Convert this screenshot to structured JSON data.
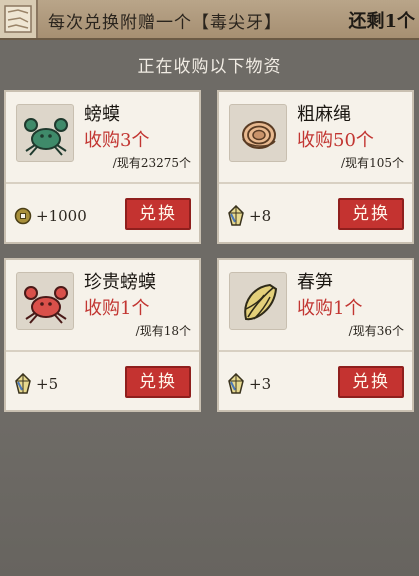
{
  "header": {
    "title": "每次兑换附赠一个【毒尖牙】",
    "remaining": "还剩1个"
  },
  "subtitle": "正在收购以下物资",
  "items": [
    {
      "name": "螃蟆",
      "buy": "收购3个",
      "have": "/现有23275个",
      "reward_icon": "copper-coin-icon",
      "reward": "+1000",
      "button": "兑换"
    },
    {
      "name": "粗麻绳",
      "buy": "收购50个",
      "have": "/现有105个",
      "reward_icon": "gem-crystal-icon",
      "reward": "+8",
      "button": "兑换"
    },
    {
      "name": "珍贵螃蟆",
      "buy": "收购1个",
      "have": "/现有18个",
      "reward_icon": "gem-crystal-icon",
      "reward": "+5",
      "button": "兑换"
    },
    {
      "name": "春笋",
      "buy": "收购1个",
      "have": "/现有36个",
      "reward_icon": "gem-crystal-icon",
      "reward": "+3",
      "button": "兑换"
    }
  ],
  "colors": {
    "accent_red": "#c43330",
    "price_red": "#c23632",
    "card_bg": "#f6f2ea",
    "page_bg": "#6e6b66"
  }
}
